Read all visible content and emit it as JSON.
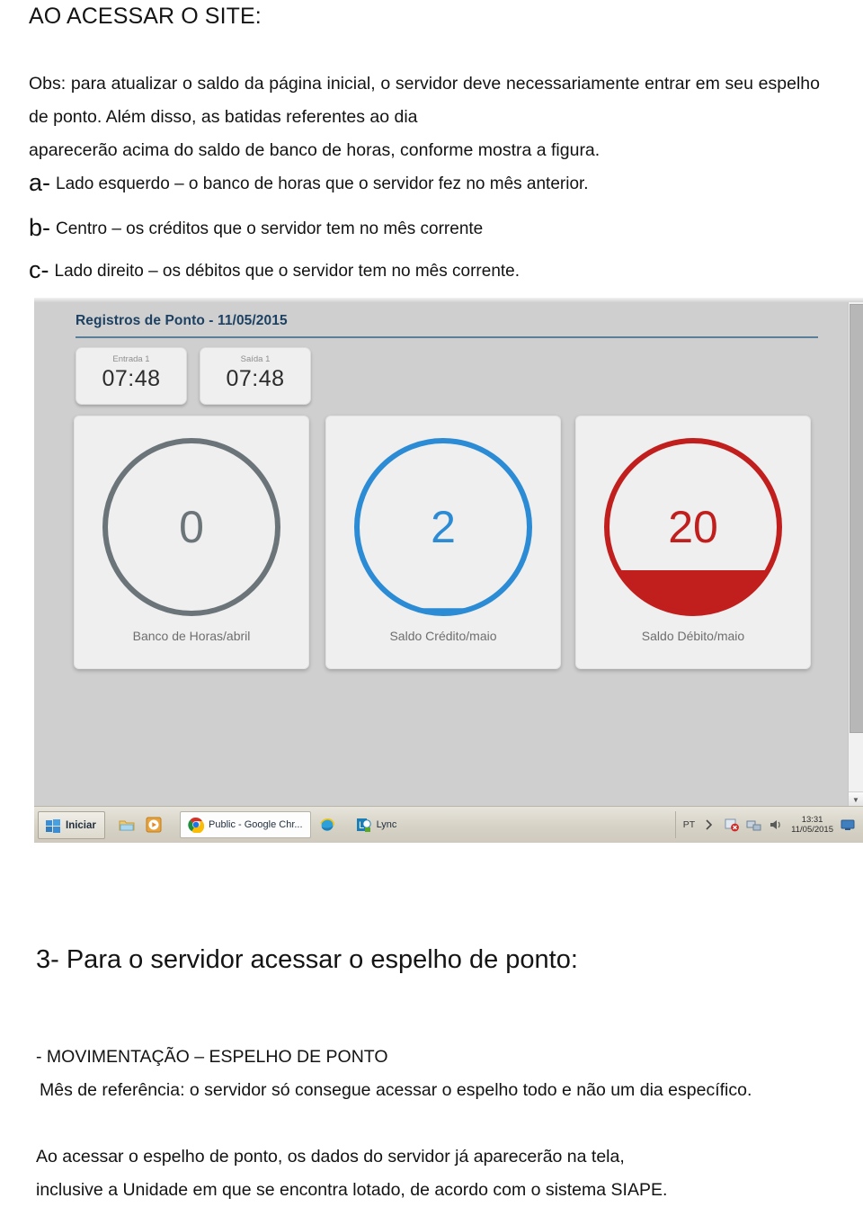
{
  "document": {
    "heading": "AO ACESSAR O SITE:",
    "obs_paragraph": "Obs: para atualizar o saldo da página inicial, o servidor deve necessariamente entrar em seu espelho de ponto. Além disso, as batidas referentes ao dia",
    "obs_lastline": "aparecerão acima do saldo de banco de horas, conforme mostra a figura.",
    "bullets": [
      {
        "mark": "a-",
        "text": "Lado esquerdo – o banco de horas que o servidor fez no mês anterior."
      },
      {
        "mark": "b-",
        "text": "Centro – os créditos que o servidor tem no mês corrente"
      },
      {
        "mark": "c-",
        "text": "Lado direito – os débitos que o servidor tem no mês corrente."
      }
    ],
    "section3_heading": "3- Para o servidor acessar o espelho de ponto:",
    "tail_line1": "- MOVIMENTAÇÃO – ESPELHO DE PONTO",
    "tail_line2": " Mês de referência: o servidor só consegue acessar o espelho todo e não um dia específico.",
    "tail_line3": "Ao acessar o espelho de ponto, os dados do servidor já aparecerão na tela,",
    "tail_line3_last": "inclusive a Unidade em que se encontra lotado, de acordo com o sistema SIAPE."
  },
  "screenshot": {
    "panel_title": "Registros de Ponto - 11/05/2015",
    "punches": [
      {
        "label": "Entrada 1",
        "time": "07:48"
      },
      {
        "label": "Saída 1",
        "time": "07:48"
      }
    ],
    "gauges": [
      {
        "value": "0",
        "label": "Banco de Horas/abril",
        "color": "#6b7478",
        "fill_pct": 0
      },
      {
        "value": "2",
        "label": "Saldo Crédito/maio",
        "color": "#2b8bd4",
        "fill_pct": 3
      },
      {
        "value": "20",
        "label": "Saldo Débito/maio",
        "color": "#c01f1d",
        "fill_pct": 25
      }
    ],
    "scrollbar": {
      "arrow_down": "▼"
    },
    "taskbar": {
      "start_label": "Iniciar",
      "quick_launch": [
        "explorer-icon",
        "media-player-icon"
      ],
      "apps": [
        {
          "icon": "chrome-icon",
          "label": "Public - Google Chr...",
          "active": true
        },
        {
          "icon": "internet-explorer-icon",
          "label": "",
          "active": false
        },
        {
          "icon": "lync-icon",
          "label": "Lync",
          "active": false
        }
      ],
      "tray": {
        "language": "PT",
        "icons": [
          "show-hidden-icons",
          "security-alert-icon",
          "network-icon",
          "volume-icon"
        ],
        "time": "13:31",
        "date": "11/05/2015",
        "show-desktop": "show-desktop-icon"
      }
    }
  }
}
